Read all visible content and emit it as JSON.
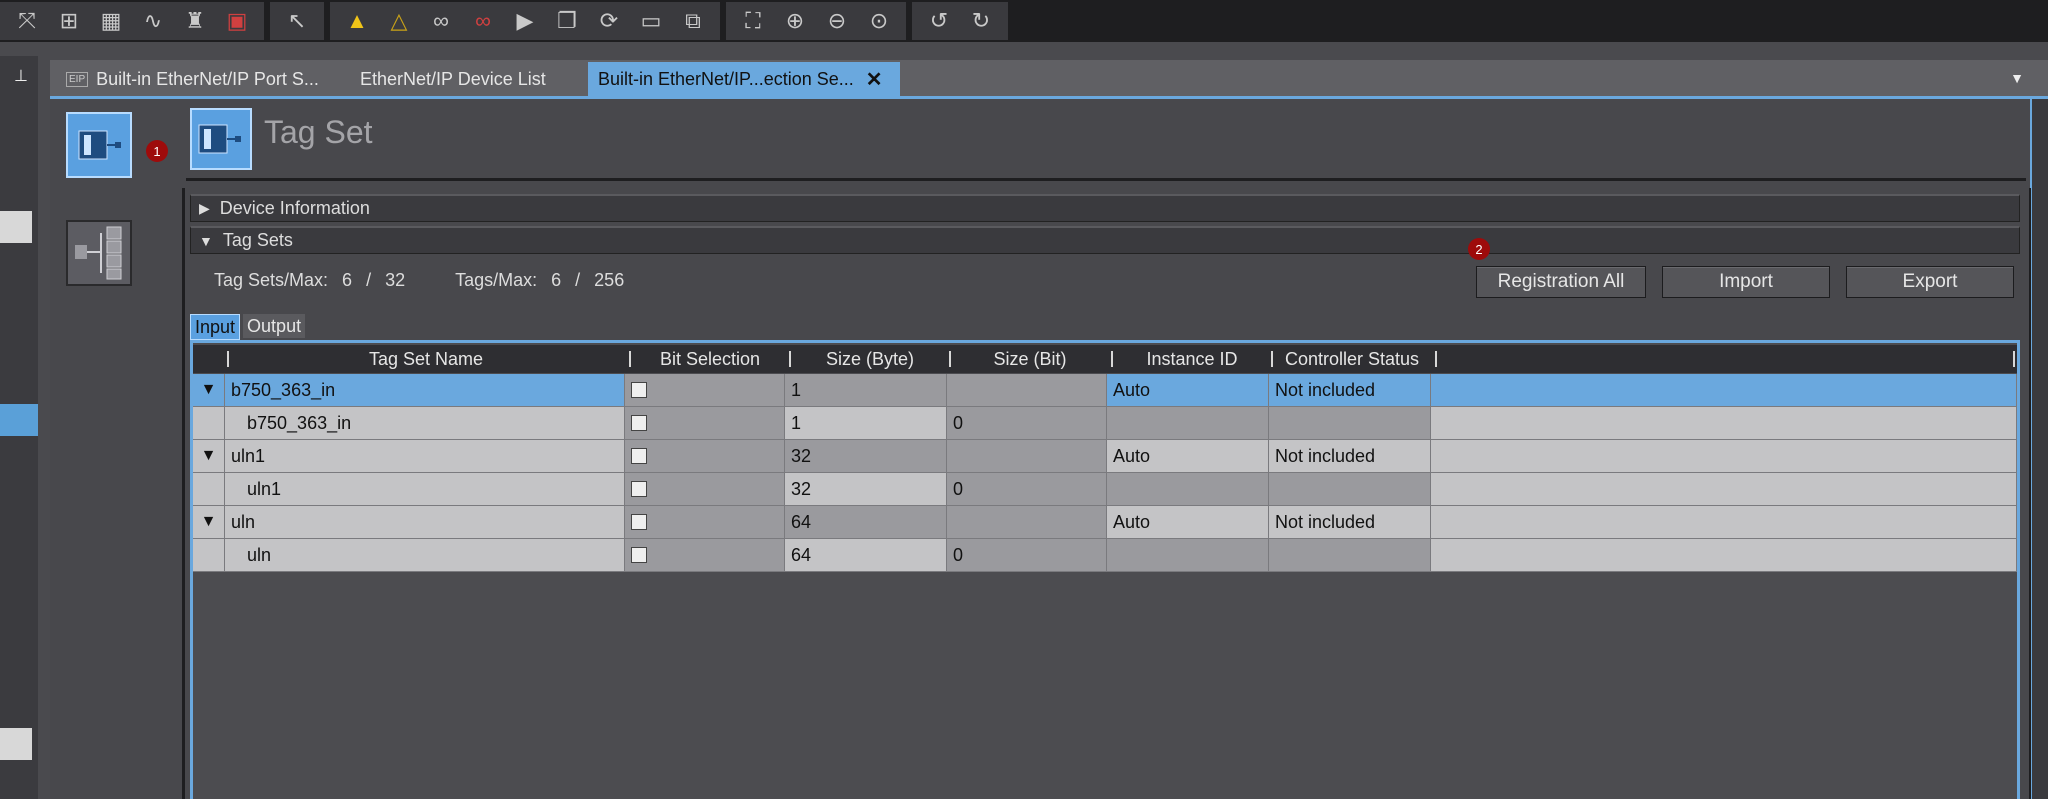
{
  "toolbar": {
    "icons": [
      "network-icon",
      "report-icon",
      "table-icon",
      "waveform-icon",
      "binoculars-icon",
      "alert-icon",
      "pointer-icon",
      "warning-icon",
      "warning-cross-icon",
      "glasses-icon",
      "glasses-red-icon",
      "play-icon",
      "stack-icon",
      "cycle-icon",
      "monitor-icon",
      "monitor-switch-icon",
      "fit-icon",
      "zoom-in-icon",
      "zoom-out-icon",
      "zoom-100-icon",
      "undo-icon",
      "redo-icon"
    ]
  },
  "tabs": [
    {
      "label": "Built-in EtherNet/IP Port S...",
      "icon_text": "EIP"
    },
    {
      "label": "EtherNet/IP Device List"
    },
    {
      "label": "Built-in EtherNet/IP...ection Se...",
      "active": true
    }
  ],
  "page": {
    "title": "Tag Set",
    "badge1": "1",
    "badge2": "2"
  },
  "sections": {
    "device_information": "Device Information",
    "tag_sets": "Tag Sets"
  },
  "stats": {
    "tag_sets_label": "Tag Sets/Max:",
    "tag_sets_value": "6",
    "tag_sets_sep": "/",
    "tag_sets_max": "32",
    "tags_label": "Tags/Max:",
    "tags_value": "6",
    "tags_sep": "/",
    "tags_max": "256"
  },
  "actions": {
    "registration_all": "Registration All",
    "import": "Import",
    "export": "Export"
  },
  "io_tabs": {
    "input": "Input",
    "output": "Output"
  },
  "grid": {
    "columns": [
      "Tag Set Name",
      "Bit Selection",
      "Size (Byte)",
      "Size (Bit)",
      "Instance ID",
      "Controller Status"
    ],
    "rows": [
      {
        "name": "b750_363_in",
        "size_byte": "1",
        "size_bit": "",
        "instance_id": "Auto",
        "status": "Not included",
        "parent": true,
        "selected": true
      },
      {
        "name": "b750_363_in",
        "size_byte": "1",
        "size_bit": "0",
        "instance_id": "",
        "status": "",
        "parent": false
      },
      {
        "name": "uln1",
        "size_byte": "32",
        "size_bit": "",
        "instance_id": "Auto",
        "status": "Not included",
        "parent": true
      },
      {
        "name": "uln1",
        "size_byte": "32",
        "size_bit": "0",
        "instance_id": "",
        "status": "",
        "parent": false
      },
      {
        "name": "uln",
        "size_byte": "64",
        "size_bit": "",
        "instance_id": "Auto",
        "status": "Not included",
        "parent": true
      },
      {
        "name": "uln",
        "size_byte": "64",
        "size_bit": "0",
        "instance_id": "",
        "status": "",
        "parent": false
      }
    ]
  }
}
